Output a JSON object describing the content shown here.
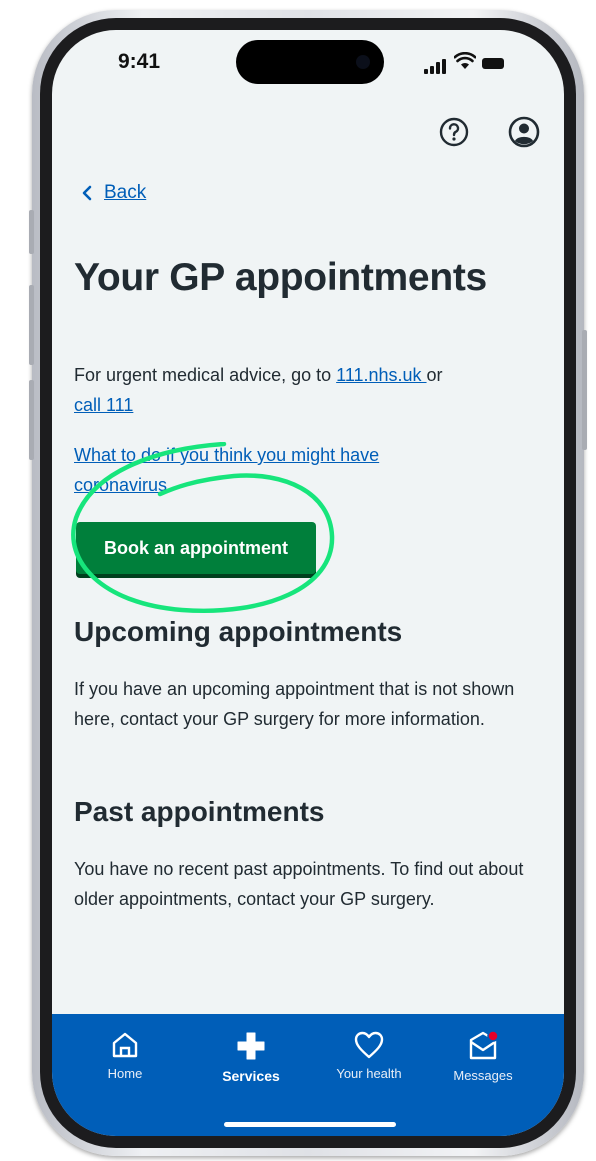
{
  "status_bar": {
    "time": "9:41"
  },
  "header": {
    "help_icon": "help-icon",
    "account_icon": "account-icon"
  },
  "nav": {
    "back_label": "Back"
  },
  "page": {
    "title": "Your GP appointments",
    "urgent": {
      "prefix": "For urgent medical advice, go to ",
      "link1": "111.nhs.uk ",
      "mid": "or",
      "link2": "call 111"
    },
    "coronavirus_link": "What to do if you think you might have coronavirus",
    "book_button": "Book an appointment",
    "upcoming": {
      "heading": "Upcoming appointments",
      "body": "If you have an upcoming appointment that is not shown here, contact your GP surgery for more information."
    },
    "past": {
      "heading": "Past appointments",
      "body": "You have no recent past appointments. To find out about older appointments, contact your GP surgery."
    }
  },
  "tab_bar": {
    "items": [
      {
        "label": "Home",
        "icon": "home-icon"
      },
      {
        "label": "Services",
        "icon": "plus-icon"
      },
      {
        "label": "Your health",
        "icon": "heart-icon"
      },
      {
        "label": "Messages",
        "icon": "messages-icon"
      }
    ],
    "active": "Services"
  },
  "colors": {
    "nhs_blue": "#005eb8",
    "nhs_green": "#007f3b",
    "page_bg": "#f0f4f5",
    "text": "#212b32",
    "highlight_ring": "#17e57c",
    "notification_dot": "#e5002b"
  }
}
